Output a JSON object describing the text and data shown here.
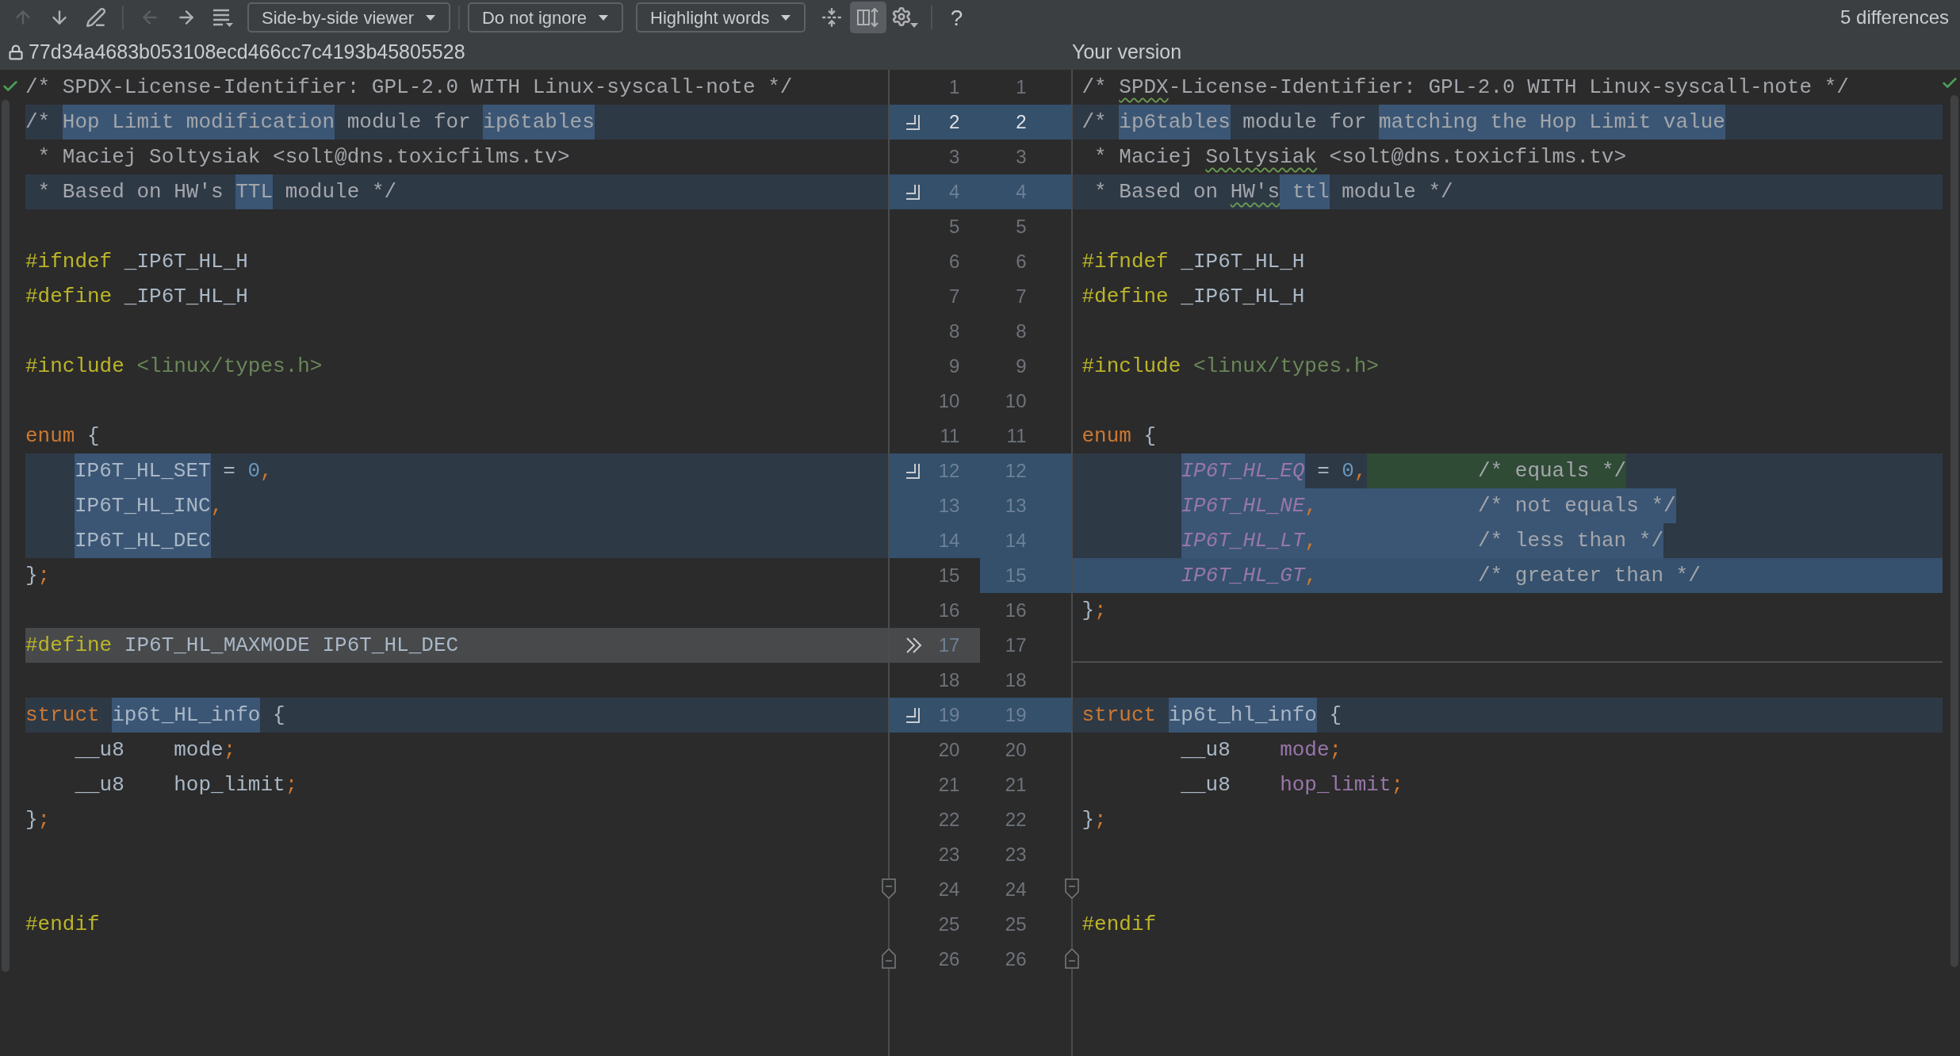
{
  "toolbar": {
    "icon_buttons": [
      {
        "disabled": true,
        "selected": false
      },
      {
        "disabled": false,
        "selected": false
      },
      {
        "disabled": false,
        "selected": false
      },
      {
        "disabled": true,
        "selected": false
      },
      {
        "disabled": false,
        "selected": false
      },
      {
        "disabled": false,
        "selected": false
      },
      {
        "disabled": false,
        "selected": false
      },
      {
        "disabled": false,
        "selected": true
      },
      {
        "disabled": false,
        "selected": false
      }
    ],
    "dropdowns": [
      "Side-by-side viewer",
      "Do not ignore",
      "Highlight words"
    ],
    "help": "?",
    "differences": "5 differences"
  },
  "header": {
    "left_title": "77d34a4683b053108ecd466cc7c4193b45805528",
    "right_title": "Your version"
  },
  "rows": [
    {
      "numbers": [
        "1",
        "1"
      ],
      "current": false,
      "left": {
        "kind": "unchanged",
        "tokens": [
          {
            "text": "/* SPDX-License-Identifier: GPL-2.0 WITH Linux-syscall-note */",
            "kind": "comment"
          }
        ]
      },
      "right": {
        "kind": "unchanged",
        "tokens": [
          {
            "text": "/* ",
            "kind": "comment"
          },
          {
            "text": "SPDX",
            "kind": "comment",
            "typo": true
          },
          {
            "text": "-License-Identifier: GPL-2.0 WITH Linux-syscall-note */",
            "kind": "comment"
          }
        ]
      }
    },
    {
      "numbers": [
        "2",
        "2"
      ],
      "current": true,
      "gutter_action": {
        "kind": "apply"
      },
      "left": {
        "kind": "modified",
        "tokens": [
          {
            "text": "/* ",
            "kind": "comment"
          },
          {
            "text": "Hop Limit modification",
            "kind": "comment",
            "changed": true
          },
          {
            "text": " module for ",
            "kind": "comment"
          },
          {
            "text": "ip6tables",
            "kind": "comment",
            "changed": true
          }
        ]
      },
      "right": {
        "kind": "modified",
        "tokens": [
          {
            "text": "/* ",
            "kind": "comment"
          },
          {
            "text": "ip6tables",
            "kind": "comment",
            "changed": true
          },
          {
            "text": " module for ",
            "kind": "comment"
          },
          {
            "text": "matching the Hop Limit value",
            "kind": "comment",
            "changed": true
          }
        ]
      }
    },
    {
      "numbers": [
        "3",
        "3"
      ],
      "current": false,
      "left": {
        "kind": "unchanged",
        "tokens": [
          {
            "text": " * Maciej Soltysiak <solt@dns.toxicfilms.tv>",
            "kind": "comment"
          }
        ]
      },
      "right": {
        "kind": "unchanged",
        "tokens": [
          {
            "text": " * Maciej ",
            "kind": "comment"
          },
          {
            "text": "Soltysiak",
            "kind": "comment",
            "typo": true
          },
          {
            "text": " <solt@dns.toxicfilms.tv>",
            "kind": "comment"
          }
        ]
      }
    },
    {
      "numbers": [
        "4",
        "4"
      ],
      "current": false,
      "gutter_action": {
        "kind": "apply"
      },
      "left": {
        "kind": "modified",
        "tokens": [
          {
            "text": " * Based on HW's ",
            "kind": "comment"
          },
          {
            "text": "TTL",
            "kind": "comment",
            "changed": true
          },
          {
            "text": " module */",
            "kind": "comment"
          }
        ]
      },
      "right": {
        "kind": "modified",
        "tokens": [
          {
            "text": " * Based on ",
            "kind": "comment"
          },
          {
            "text": "HW's",
            "kind": "comment",
            "typo": true
          },
          {
            "text": " ttl",
            "kind": "comment",
            "changed": true
          },
          {
            "text": " module */",
            "kind": "comment"
          }
        ]
      }
    },
    {
      "numbers": [
        "5",
        "5"
      ],
      "current": false
    },
    {
      "numbers": [
        "6",
        "6"
      ],
      "current": false,
      "left": {
        "kind": "unchanged",
        "tokens": [
          {
            "text": "#ifndef",
            "kind": "macro"
          },
          {
            "text": " _IP6T_HL_H",
            "kind": "plain"
          }
        ]
      },
      "right": {
        "kind": "unchanged",
        "tokens": [
          {
            "text": "#ifndef",
            "kind": "macro"
          },
          {
            "text": " _IP6T_HL_H",
            "kind": "plain"
          }
        ]
      }
    },
    {
      "numbers": [
        "7",
        "7"
      ],
      "current": false,
      "left": {
        "kind": "unchanged",
        "tokens": [
          {
            "text": "#define",
            "kind": "macro"
          },
          {
            "text": " _IP6T_HL_H",
            "kind": "plain"
          }
        ]
      },
      "right": {
        "kind": "unchanged",
        "tokens": [
          {
            "text": "#define",
            "kind": "macro"
          },
          {
            "text": " _IP6T_HL_H",
            "kind": "plain"
          }
        ]
      }
    },
    {
      "numbers": [
        "8",
        "8"
      ],
      "current": false
    },
    {
      "numbers": [
        "9",
        "9"
      ],
      "current": false,
      "left": {
        "kind": "unchanged",
        "tokens": [
          {
            "text": "#include",
            "kind": "macro"
          },
          {
            "text": " <linux/types.h>",
            "kind": "string"
          }
        ]
      },
      "right": {
        "kind": "unchanged",
        "tokens": [
          {
            "text": "#include",
            "kind": "macro"
          },
          {
            "text": " <linux/types.h>",
            "kind": "string"
          }
        ]
      }
    },
    {
      "numbers": [
        "10",
        "10"
      ],
      "current": false
    },
    {
      "numbers": [
        "11",
        "11"
      ],
      "current": false,
      "left": {
        "kind": "unchanged",
        "tokens": [
          {
            "text": "enum",
            "kind": "keyword"
          },
          {
            "text": " {",
            "kind": "plain"
          }
        ]
      },
      "right": {
        "kind": "unchanged",
        "tokens": [
          {
            "text": "enum",
            "kind": "keyword"
          },
          {
            "text": " {",
            "kind": "plain"
          }
        ]
      }
    },
    {
      "numbers": [
        "12",
        "12"
      ],
      "current": false,
      "gutter_action": {
        "kind": "apply"
      },
      "left": {
        "kind": "modified",
        "indented": true,
        "tokens": [
          {
            "text": "IP6T_HL_SET",
            "kind": "plain",
            "changed": true
          },
          {
            "text": " = ",
            "kind": "plain"
          },
          {
            "text": "0",
            "kind": "number"
          },
          {
            "text": ",",
            "kind": "punct"
          }
        ]
      },
      "right": {
        "kind": "modified",
        "indented": true,
        "tokens": [
          {
            "text": "IP6T_HL_EQ",
            "kind": "constant",
            "changed": true
          },
          {
            "text": " = ",
            "kind": "plain"
          },
          {
            "text": "0",
            "kind": "number"
          },
          {
            "text": ",",
            "kind": "punct"
          },
          {
            "text": "         /* equals */",
            "kind": "comment",
            "inserted": true
          }
        ]
      }
    },
    {
      "numbers": [
        "13",
        "13"
      ],
      "current": false,
      "left": {
        "kind": "modified",
        "indented": true,
        "tokens": [
          {
            "text": "IP6T_HL_INC",
            "kind": "plain",
            "changed": true
          },
          {
            "text": ",",
            "kind": "punct"
          }
        ]
      },
      "right": {
        "kind": "modified",
        "indented": true,
        "tokens": [
          {
            "text": "IP6T_HL_NE",
            "kind": "constant",
            "changed": true
          },
          {
            "text": ",",
            "kind": "punct",
            "changed": true
          },
          {
            "text": "             /* not equals */",
            "kind": "comment",
            "changed": true
          }
        ]
      }
    },
    {
      "numbers": [
        "14",
        "14"
      ],
      "current": false,
      "left": {
        "kind": "modified",
        "indented": true,
        "tokens": [
          {
            "text": "IP6T_HL_DEC",
            "kind": "plain",
            "changed": true
          }
        ]
      },
      "right": {
        "kind": "modified",
        "indented": true,
        "tokens": [
          {
            "text": "IP6T_HL_LT",
            "kind": "constant",
            "changed": true
          },
          {
            "text": ",",
            "kind": "punct",
            "changed": true
          },
          {
            "text": "             /* less than */",
            "kind": "comment",
            "changed": true
          }
        ]
      }
    },
    {
      "numbers": [
        "15",
        "15"
      ],
      "current": false,
      "left": {
        "kind": "unchanged",
        "tokens": [
          {
            "text": "}",
            "kind": "plain"
          },
          {
            "text": ";",
            "kind": "punct"
          }
        ]
      },
      "right": {
        "kind": "inserted",
        "indented": true,
        "tokens": [
          {
            "text": "IP6T_HL_GT",
            "kind": "constant"
          },
          {
            "text": ",",
            "kind": "punct"
          },
          {
            "text": "             /* greater than */",
            "kind": "comment"
          }
        ]
      }
    },
    {
      "numbers": [
        "16",
        "16"
      ],
      "current": false,
      "right": {
        "kind": "unchanged",
        "tokens": [
          {
            "text": "}",
            "kind": "plain"
          },
          {
            "text": ";",
            "kind": "punct"
          }
        ]
      }
    },
    {
      "numbers": [
        "17",
        "17"
      ],
      "current": false,
      "gutter_action": {
        "kind": "append"
      },
      "left": {
        "kind": "deleted",
        "tokens": [
          {
            "text": "#define",
            "kind": "macro"
          },
          {
            "text": " IP6T_HL_MAXMODE IP6T_HL_DEC",
            "kind": "plain"
          }
        ]
      },
      "right": {
        "kind": "separator"
      }
    },
    {
      "numbers": [
        "18",
        "18"
      ],
      "current": false
    },
    {
      "numbers": [
        "19",
        "19"
      ],
      "current": false,
      "gutter_action": {
        "kind": "apply"
      },
      "left": {
        "kind": "modified",
        "tokens": [
          {
            "text": "struct ",
            "kind": "keyword"
          },
          {
            "text": "ip6t_HL_info",
            "kind": "plain",
            "changed": true
          },
          {
            "text": " {",
            "kind": "plain"
          }
        ]
      },
      "right": {
        "kind": "modified",
        "tokens": [
          {
            "text": "struct ",
            "kind": "keyword"
          },
          {
            "text": "ip6t_hl_info",
            "kind": "plain",
            "changed": true
          },
          {
            "text": " {",
            "kind": "plain"
          }
        ]
      }
    },
    {
      "numbers": [
        "20",
        "20"
      ],
      "current": false,
      "left": {
        "kind": "unchanged",
        "tokens": [
          {
            "text": "    __u8    mode",
            "kind": "plain"
          },
          {
            "text": ";",
            "kind": "punct"
          }
        ]
      },
      "right": {
        "kind": "unchanged",
        "tokens": [
          {
            "text": "        __u8    ",
            "kind": "plain"
          },
          {
            "text": "mode",
            "kind": "field"
          },
          {
            "text": ";",
            "kind": "punct"
          }
        ]
      }
    },
    {
      "numbers": [
        "21",
        "21"
      ],
      "current": false,
      "left": {
        "kind": "unchanged",
        "tokens": [
          {
            "text": "    __u8    hop_limit",
            "kind": "plain"
          },
          {
            "text": ";",
            "kind": "punct"
          }
        ]
      },
      "right": {
        "kind": "unchanged",
        "tokens": [
          {
            "text": "        __u8    ",
            "kind": "plain"
          },
          {
            "text": "hop_limit",
            "kind": "field"
          },
          {
            "text": ";",
            "kind": "punct"
          }
        ]
      }
    },
    {
      "numbers": [
        "22",
        "22"
      ],
      "current": false,
      "left": {
        "kind": "unchanged",
        "tokens": [
          {
            "text": "}",
            "kind": "plain"
          },
          {
            "text": ";",
            "kind": "punct"
          }
        ]
      },
      "right": {
        "kind": "unchanged",
        "tokens": [
          {
            "text": "}",
            "kind": "plain"
          },
          {
            "text": ";",
            "kind": "punct"
          }
        ]
      }
    },
    {
      "numbers": [
        "23",
        "23"
      ],
      "current": false
    },
    {
      "numbers": [
        "24",
        "24"
      ],
      "current": false,
      "fold": {
        "kind": "start"
      }
    },
    {
      "numbers": [
        "25",
        "25"
      ],
      "current": false,
      "left": {
        "kind": "unchanged",
        "tokens": [
          {
            "text": "#endif",
            "kind": "macro"
          }
        ]
      },
      "right": {
        "kind": "unchanged",
        "tokens": [
          {
            "text": "#endif",
            "kind": "macro"
          }
        ]
      }
    },
    {
      "numbers": [
        "26",
        "26"
      ],
      "current": false,
      "fold": {
        "kind": "end"
      }
    }
  ]
}
